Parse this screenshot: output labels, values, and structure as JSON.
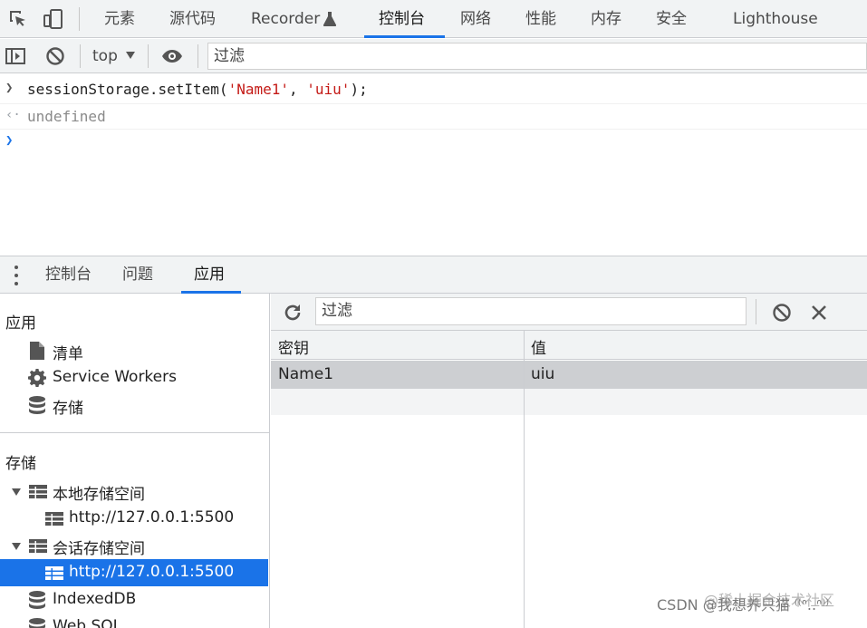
{
  "top_tabs": [
    "元素",
    "源代码",
    "Recorder",
    "控制台",
    "网络",
    "性能",
    "内存",
    "安全",
    "Lighthouse"
  ],
  "active_top_tab": "控制台",
  "console_toolbar": {
    "context": "top",
    "filter_placeholder": "过滤"
  },
  "console": {
    "input_prefix": "sessionStorage.setItem(",
    "arg1": "'Name1'",
    "sep": ", ",
    "arg2": "'uiu'",
    "input_suffix": ");",
    "result": "undefined"
  },
  "drawer_tabs": [
    "控制台",
    "问题",
    "应用"
  ],
  "active_drawer_tab": "应用",
  "sidebar": {
    "app_section": "应用",
    "app_items": [
      "清单",
      "Service Workers",
      "存储"
    ],
    "storage_section": "存储",
    "local_storage": "本地存储空间",
    "local_origin": "http://127.0.0.1:5500",
    "session_storage": "会话存储空间",
    "session_origin": "http://127.0.0.1:5500",
    "indexeddb": "IndexedDB",
    "websql": "Web SQL"
  },
  "storage_panel": {
    "filter_placeholder": "过滤",
    "columns": [
      "密钥",
      "值"
    ],
    "rows": [
      {
        "key": "Name1",
        "value": "uiu"
      }
    ]
  },
  "watermark": "CSDN @我想养只猫 ⁽⁽ᐢ..ᐢ⁾⁾",
  "watermark2": "@稀土掘金技术社区",
  "colors": {
    "accent": "#1a73e8",
    "string": "#c41a16",
    "toolbar_bg": "#f1f3f4"
  }
}
